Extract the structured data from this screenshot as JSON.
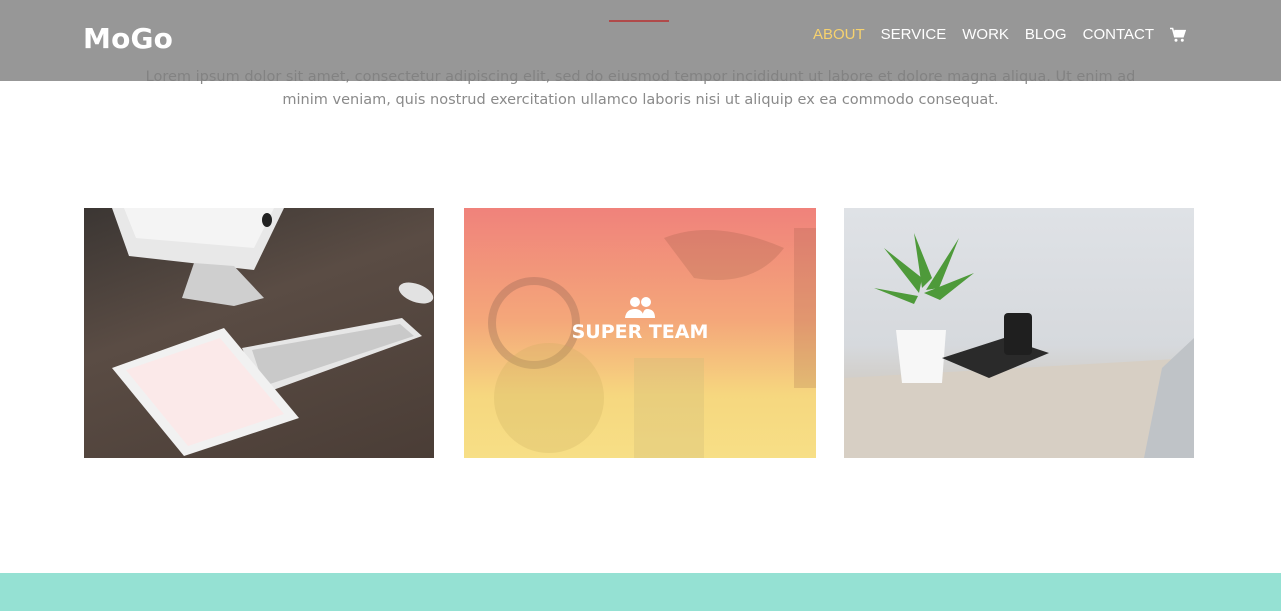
{
  "header": {
    "logo": "MoGo",
    "nav": [
      {
        "label": "ABOUT",
        "active": true
      },
      {
        "label": "SERVICE",
        "active": false
      },
      {
        "label": "WORK",
        "active": false
      },
      {
        "label": "BLOG",
        "active": false
      },
      {
        "label": "CONTACT",
        "active": false
      }
    ],
    "cart_icon": "shopping-cart-icon",
    "active_color": "#f7d26e"
  },
  "intro": {
    "line1": "Lorem ipsum dolor sit amet, consectetur adipiscing elit, sed do eiusmod tempor incididunt ut labore et dolore magna aliqua. Ut enim ad",
    "line2": "minim veniam, quis nostrud exercitation ullamco laboris nisi ut aliquip ex ea commodo consequat."
  },
  "cards": [
    {
      "image": "desk-with-computer-keyboard-tablet"
    },
    {
      "label": "SUPER TEAM",
      "icon": "users-icon"
    },
    {
      "image": "desk-with-plant-camera-laptop"
    }
  ],
  "colors": {
    "footer_band": "#95e1d3",
    "accent_line": "#b04a4a"
  }
}
